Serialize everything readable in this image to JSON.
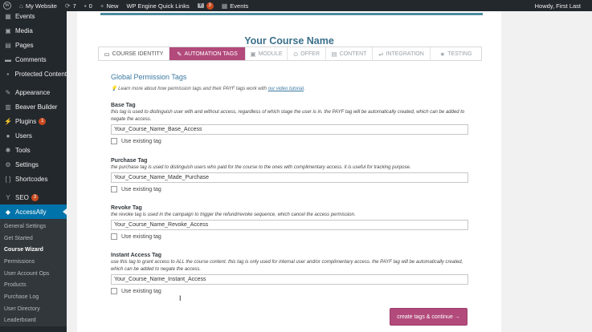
{
  "adminbar": {
    "site_name": "My Website",
    "updates_count": "7",
    "comments_count": "0",
    "new_label": "New",
    "wpengine_label": "WP Engine Quick Links",
    "yoast_badge": "3",
    "events_label": "Events",
    "howdy": "Howdy, First Last"
  },
  "sidebar": {
    "items": [
      {
        "label": "Events",
        "icon": "calendar-icon"
      },
      {
        "label": "Media",
        "icon": "media-icon"
      },
      {
        "label": "Pages",
        "icon": "pages-icon"
      },
      {
        "label": "Comments",
        "icon": "comments-icon"
      },
      {
        "label": "Protected Content",
        "icon": "lock-icon"
      },
      {
        "label": "Appearance",
        "icon": "brush-icon"
      },
      {
        "label": "Beaver Builder",
        "icon": "layout-icon"
      },
      {
        "label": "Plugins",
        "icon": "plugin-icon",
        "badge": "1"
      },
      {
        "label": "Users",
        "icon": "users-icon"
      },
      {
        "label": "Tools",
        "icon": "wrench-icon"
      },
      {
        "label": "Settings",
        "icon": "settings-icon"
      },
      {
        "label": "Shortcodes",
        "icon": "shortcode-icon"
      },
      {
        "label": "SEO",
        "icon": "yoast-icon",
        "badge": "3"
      },
      {
        "label": "AccessAlly",
        "icon": "accessally-icon"
      }
    ],
    "submenu": [
      "General Settings",
      "Get Started",
      "Course Wizard",
      "Permissions",
      "User Account Ops",
      "Products",
      "Purchase Log",
      "User Directory",
      "Leaderboard"
    ]
  },
  "main": {
    "course_name": "Your Course Name",
    "tabs": [
      {
        "label": "COURSE IDENTITY",
        "icon": "monitor-icon"
      },
      {
        "label": "AUTOMATION TAGS",
        "icon": "tag-icon"
      },
      {
        "label": "MODULE",
        "icon": "module-icon"
      },
      {
        "label": "OFFER",
        "icon": "offer-icon"
      },
      {
        "label": "CONTENT",
        "icon": "content-icon"
      },
      {
        "label": "INTEGRATION",
        "icon": "integration-icon"
      },
      {
        "label": "TESTING",
        "icon": "star-icon"
      }
    ],
    "section_title": "Global Permission Tags",
    "info_text": "Learn more about how permission tags and their PAYF tags work with ",
    "info_link": "our video tutorial",
    "info_end": ".",
    "fields": [
      {
        "label": "Base Tag",
        "description": "this tag is used to distinguish user with and without access, regardless of which stage the user is in. the PAYF tag will be automatically created, which can be added to negate the access.",
        "value": "Your_Course_Name_Base_Access",
        "checkbox_label": "Use existing tag"
      },
      {
        "label": "Purchase Tag",
        "description": "the purchase tag is used to distinguish users who paid for the course to the ones with complimentary access. it is useful for tracking purpose.",
        "value": "Your_Course_Name_Made_Purchase",
        "checkbox_label": "Use existing tag"
      },
      {
        "label": "Revoke Tag",
        "description": "the revoke tag is used in the campaign to trigger the refund/revoke sequence, which cancel the access permission.",
        "value": "Your_Course_Name_Revoke_Access",
        "checkbox_label": "Use existing tag"
      },
      {
        "label": "Instant Access Tag",
        "description": "use this tag to grant access to ALL the course content. this tag is only used for internal user and/or complimentary access. the PAYF tag will be automatically created, which can be added to negate the access.",
        "value": "Your_Course_Name_Instant_Access",
        "checkbox_label": "Use existing tag"
      }
    ],
    "submit_label": "create tags & continue →"
  },
  "colors": {
    "accent": "#b24a7b",
    "title_blue": "#3b6f8a",
    "admin_dark": "#23282d",
    "wp_blue": "#0073aa"
  }
}
